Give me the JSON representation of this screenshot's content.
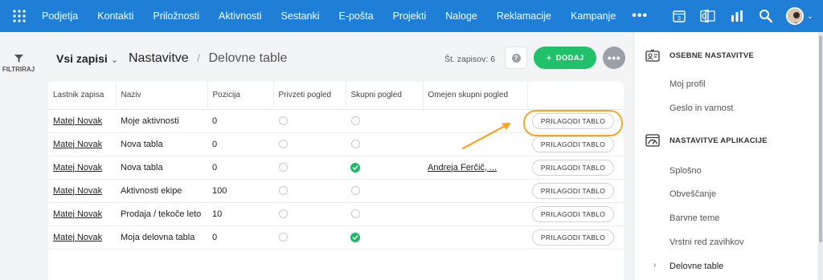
{
  "topnav": {
    "items": [
      "Podjetja",
      "Kontakti",
      "Priložnosti",
      "Aktivnosti",
      "Sestanki",
      "E-pošta",
      "Projekti",
      "Naloge",
      "Reklamacije",
      "Kampanje"
    ],
    "more_label": "•••",
    "calendar_day": "3",
    "icons": [
      "apps-grid-icon",
      "calendar-icon",
      "outlook-icon",
      "bar-chart-icon",
      "search-icon",
      "user-avatar"
    ]
  },
  "leftbar": {
    "filter_label": "FILTRIRAJ"
  },
  "header": {
    "view_selector": "Vsi zapisi",
    "breadcrumb_parent": "Nastavitve",
    "breadcrumb_separator": "/",
    "breadcrumb_current": "Delovne table",
    "record_count": "Št. zapisov: 6",
    "help_label": "?",
    "add_label": "DODAJ",
    "add_plus": "+",
    "more_label": "•••"
  },
  "table": {
    "columns": [
      "Lastnik zapisa",
      "Naziv",
      "Pozicija",
      "Privzeti pogled",
      "Skupni pogled",
      "Omejen skupni pogled",
      ""
    ],
    "rows": [
      {
        "owner": "Matej Novak",
        "name": "Moje aktivnosti",
        "position": "0",
        "default_view": false,
        "shared_view": false,
        "limited_shared": "",
        "action": "PRILAGODI TABLO"
      },
      {
        "owner": "Matej Novak",
        "name": "Nova tabla",
        "position": "0",
        "default_view": false,
        "shared_view": false,
        "limited_shared": "",
        "action": "PRILAGODI TABLO"
      },
      {
        "owner": "Matej Novak",
        "name": "Nova tabla",
        "position": "0",
        "default_view": false,
        "shared_view": true,
        "limited_shared": "Andreja Ferčič, ...",
        "action": "PRILAGODI TABLO"
      },
      {
        "owner": "Matej Novak",
        "name": "Aktivnosti ekipe",
        "position": "100",
        "default_view": false,
        "shared_view": false,
        "limited_shared": "",
        "action": "PRILAGODI TABLO"
      },
      {
        "owner": "Matej Novak",
        "name": "Prodaja / tekoče leto",
        "position": "10",
        "default_view": false,
        "shared_view": false,
        "limited_shared": "",
        "action": "PRILAGODI TABLO"
      },
      {
        "owner": "Matej Novak",
        "name": "Moja delovna tabla",
        "position": "0",
        "default_view": false,
        "shared_view": true,
        "limited_shared": "",
        "action": "PRILAGODI TABLO"
      }
    ]
  },
  "settings_panel": {
    "personal_title": "OSEBNE NASTAVITVE",
    "personal_items": [
      "Moj profil",
      "Geslo in varnost"
    ],
    "app_title": "NASTAVITVE APLIKACIJE",
    "app_items": [
      "Splošno",
      "Obveščanje",
      "Barvne teme",
      "Vrstni red zavihkov",
      "Delovne table"
    ],
    "active_item": "Delovne table"
  },
  "colors": {
    "nav_bg": "#1f7fd6",
    "accent_green": "#20c16a",
    "highlight_orange": "#f5a623"
  }
}
